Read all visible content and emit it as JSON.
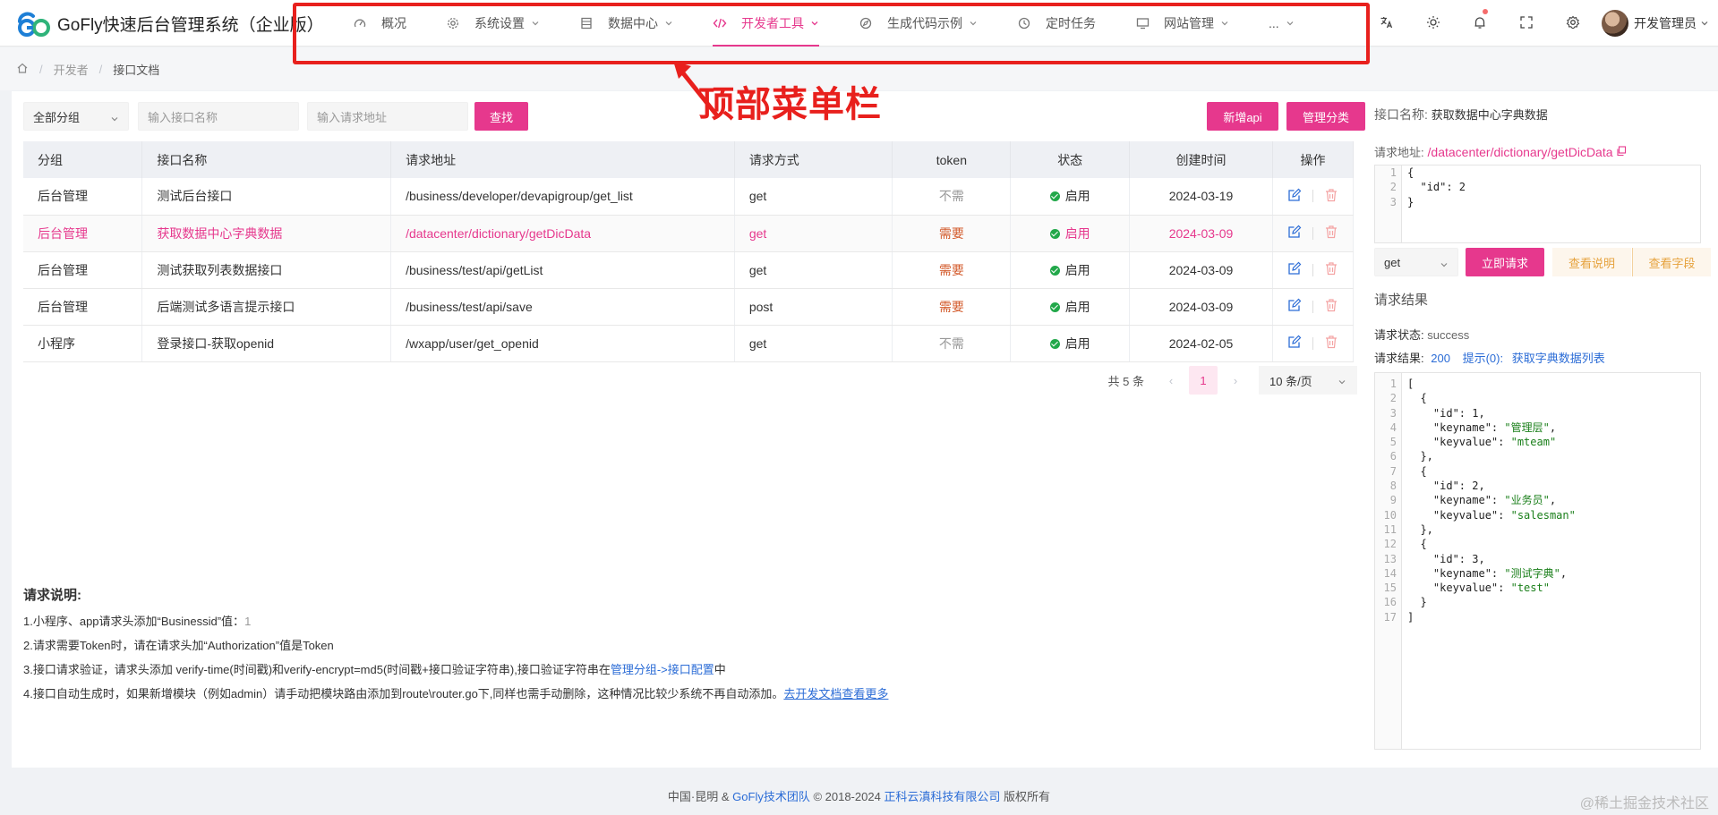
{
  "app": {
    "title": "GoFly快速后台管理系统（企业版）"
  },
  "nav": [
    {
      "label": "概况",
      "icon": "dashboard-icon",
      "dropdown": false
    },
    {
      "label": "系统设置",
      "icon": "gear-icon",
      "dropdown": true
    },
    {
      "label": "数据中心",
      "icon": "database-icon",
      "dropdown": true
    },
    {
      "label": "开发者工具",
      "icon": "code-icon",
      "dropdown": true,
      "active": true
    },
    {
      "label": "生成代码示例",
      "icon": "compass-icon",
      "dropdown": true
    },
    {
      "label": "定时任务",
      "icon": "clock-icon",
      "dropdown": false
    },
    {
      "label": "网站管理",
      "icon": "monitor-icon",
      "dropdown": true
    },
    {
      "label": "...",
      "icon": "",
      "dropdown": true
    }
  ],
  "header": {
    "user_name": "开发管理员"
  },
  "annotation": {
    "text": "顶部菜单栏"
  },
  "breadcrumb": {
    "level1": "开发者",
    "level2": "接口文档"
  },
  "filters": {
    "group_select": "全部分组",
    "name_placeholder": "输入接口名称",
    "url_placeholder": "输入请求地址",
    "search_button": "查找",
    "add_button": "新增api",
    "manage_button": "管理分类"
  },
  "table": {
    "headers": [
      "分组",
      "接口名称",
      "请求地址",
      "请求方式",
      "token",
      "状态",
      "创建时间",
      "操作"
    ],
    "rows": [
      {
        "group": "后台管理",
        "name": "测试后台接口",
        "url": "/business/developer/devapigroup/get_list",
        "method": "get",
        "token": "不需",
        "status": "启用",
        "date": "2024-03-19"
      },
      {
        "group": "后台管理",
        "name": "获取数据中心字典数据",
        "url": "/datacenter/dictionary/getDicData",
        "method": "get",
        "token": "需要",
        "status": "启用",
        "date": "2024-03-09"
      },
      {
        "group": "后台管理",
        "name": "测试获取列表数据接口",
        "url": "/business/test/api/getList",
        "method": "get",
        "token": "需要",
        "status": "启用",
        "date": "2024-03-09"
      },
      {
        "group": "后台管理",
        "name": "后端测试多语言提示接口",
        "url": "/business/test/api/save",
        "method": "post",
        "token": "需要",
        "status": "启用",
        "date": "2024-03-09"
      },
      {
        "group": "小程序",
        "name": "登录接口-获取openid",
        "url": "/wxapp/user/get_openid",
        "method": "get",
        "token": "不需",
        "status": "启用",
        "date": "2024-02-05"
      }
    ]
  },
  "pager": {
    "total": "共 5 条",
    "current": "1",
    "size": "10 条/页"
  },
  "notes": {
    "title": "请求说明:",
    "l1a": "1.小程序、app请求头添加“Businessid”值：",
    "l1b": "1",
    "l2": "2.请求需要Token时，请在请求头加“Authorization”值是Token",
    "l3a": "3.接口请求验证，请求头添加 verify-time(时间戳)和verify-encrypt=md5(时间戳+接口验证字符串),接口验证字符串在",
    "l3b": "管理分组->接口配置",
    "l3c": "中",
    "l4a": "4.接口自动生成时，如果新增模块（例如admin）请手动把模块路由添加到route\\router.go下,同样也需手动删除，这种情况比较少系统不再自动添加。",
    "l4b": "去开发文档查看更多"
  },
  "side": {
    "name_label": "接口名称:",
    "name_value": "获取数据中心字典数据",
    "url_label": "请求地址:",
    "url_value": "/datacenter/dictionary/getDicData",
    "params_code": [
      "{",
      "  \"id\": 2",
      "}"
    ],
    "method": "get",
    "request_button": "立即请求",
    "doc_button": "查看说明",
    "fields_button": "查看字段",
    "result_title": "请求结果",
    "status_label": "请求状态:",
    "status_value": "success",
    "result_label": "请求结果:",
    "result_code": "200",
    "result_hint": "提示(0):",
    "result_msg": "获取字典数据列表",
    "result_lines": [
      "[",
      "  {",
      "    \"id\": 1,",
      "    \"keyname\": \"管理层\",",
      "    \"keyvalue\": \"mteam\"",
      "  },",
      "  {",
      "    \"id\": 2,",
      "    \"keyname\": \"业务员\",",
      "    \"keyvalue\": \"salesman\"",
      "  },",
      "  {",
      "    \"id\": 3,",
      "    \"keyname\": \"测试字典\",",
      "    \"keyvalue\": \"test\"",
      "  }",
      "]"
    ]
  },
  "footer": {
    "a": "中国·昆明 & ",
    "b": "GoFly技术团队",
    "c": " © 2018-2024 ",
    "d": "正科云滇科技有限公司",
    "e": " 版权所有",
    "watermark": "@稀土掘金技术社区"
  },
  "colors": {
    "accent": "#e6388d",
    "annotation": "#e8201d",
    "success": "#22a84a",
    "warn": "#d35b2c"
  }
}
